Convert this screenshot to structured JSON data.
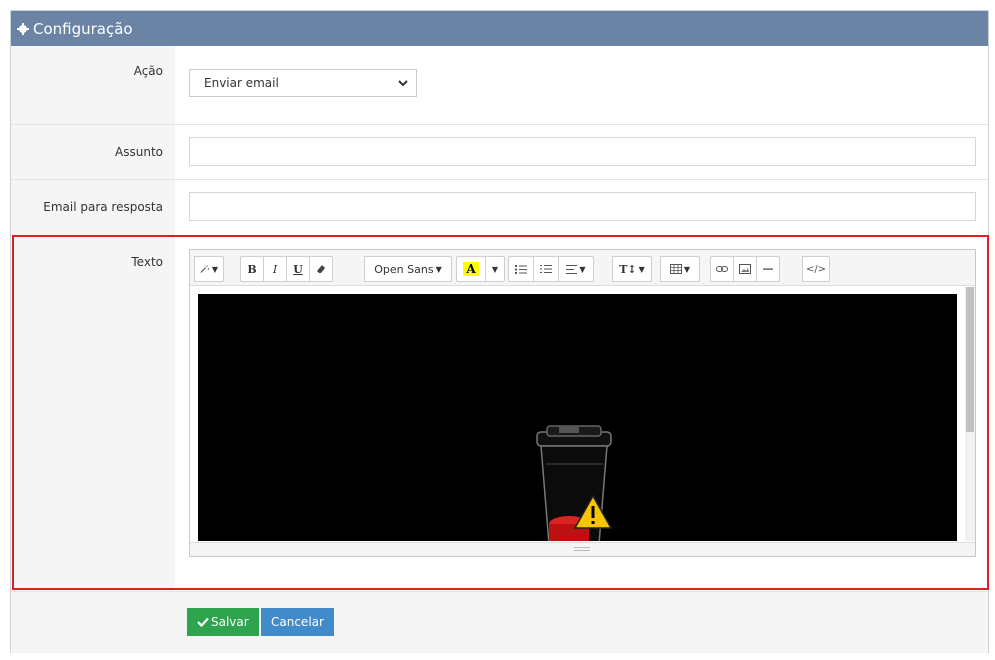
{
  "panel": {
    "title": "Configuração"
  },
  "form": {
    "acao": {
      "label": "Ação",
      "value": "Enviar email"
    },
    "assunto": {
      "label": "Assunto",
      "value": ""
    },
    "email_resposta": {
      "label": "Email para resposta",
      "value": ""
    },
    "texto": {
      "label": "Texto"
    }
  },
  "toolbar": {
    "font_name": "Open Sans",
    "buttons": [
      "magic-wand",
      "bold",
      "italic",
      "underline",
      "eraser",
      "font-family",
      "text-color",
      "text-color-caret",
      "unordered-list",
      "ordered-list",
      "paragraph-align",
      "font-size",
      "table",
      "link",
      "picture",
      "horizontal-rule",
      "code-view"
    ]
  },
  "actions": {
    "save_label": "Salvar",
    "cancel_label": "Cancelar"
  },
  "colors": {
    "header": "#6b84a6",
    "save": "#2ea44f",
    "cancel": "#428bca",
    "highlight": "#e02020"
  }
}
